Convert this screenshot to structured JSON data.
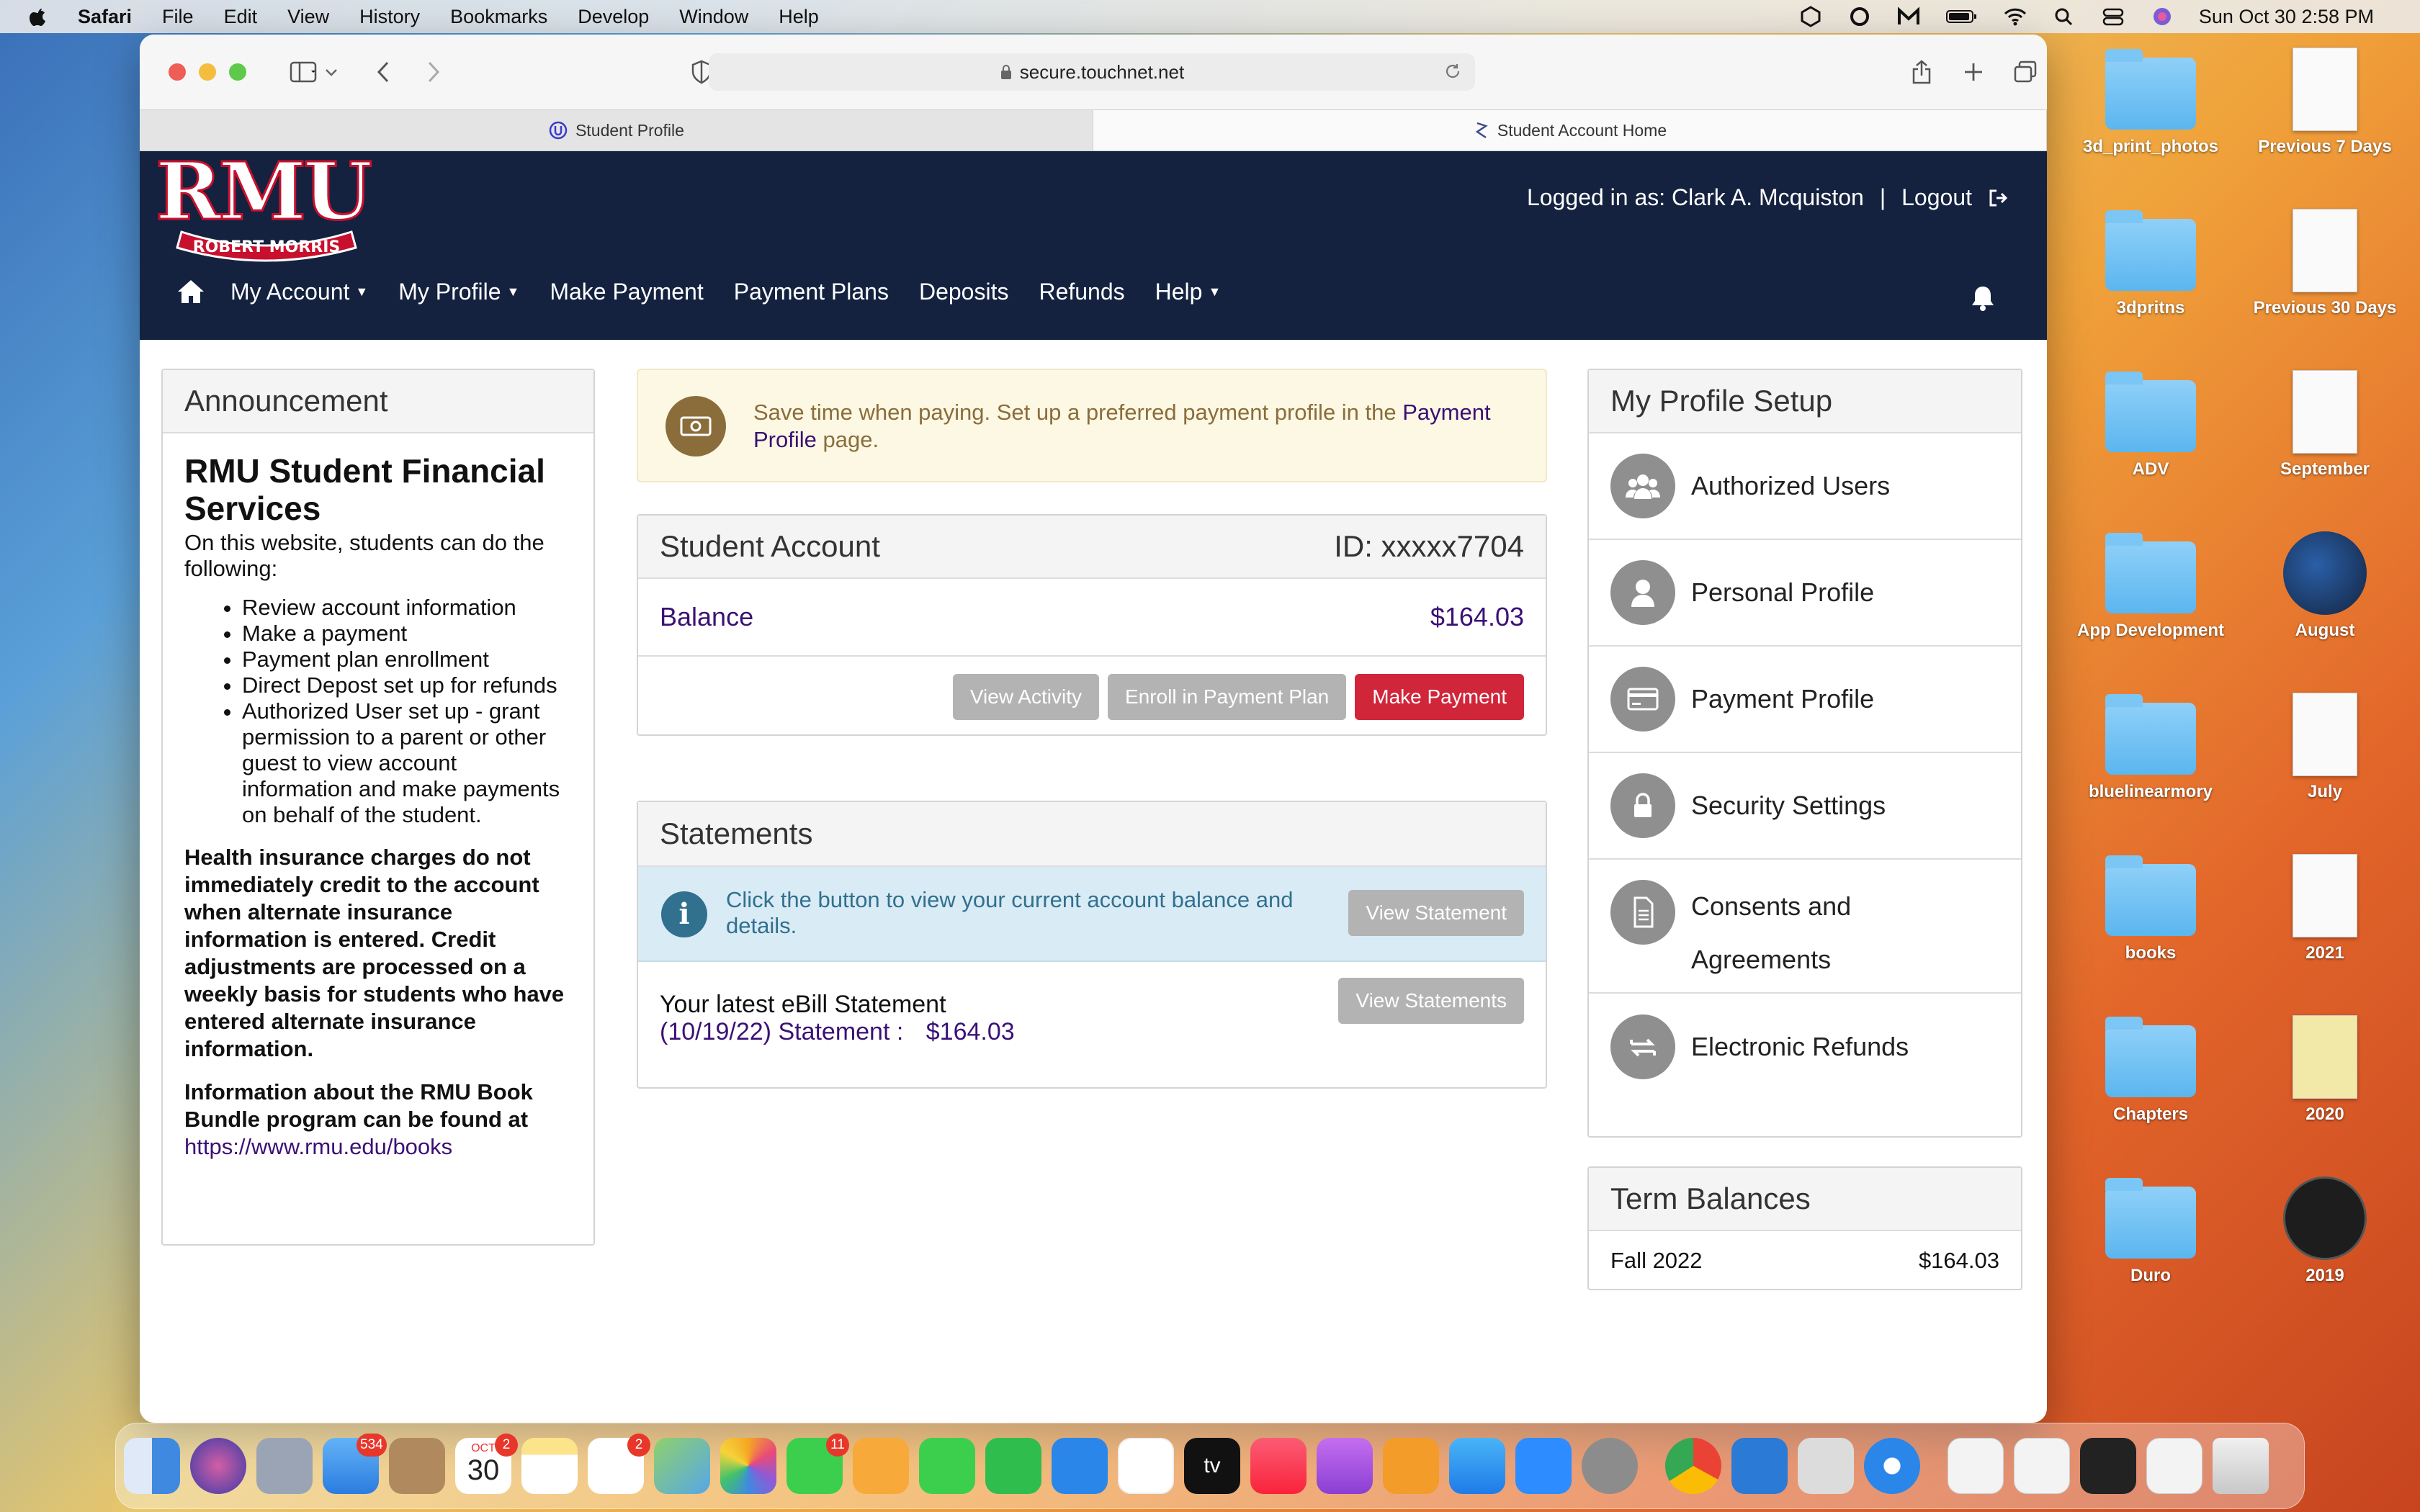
{
  "menubar": {
    "app": "Safari",
    "items": [
      "File",
      "Edit",
      "View",
      "History",
      "Bookmarks",
      "Develop",
      "Window",
      "Help"
    ],
    "clock": "Sun Oct 30  2:58 PM"
  },
  "browser": {
    "url": "secure.touchnet.net",
    "tabs": [
      {
        "label": "Student Profile",
        "icon": "touchnet-icon"
      },
      {
        "label": "Student Account Home",
        "icon": "touchnet-icon"
      }
    ]
  },
  "header": {
    "logo_text": "RMU",
    "logo_sub": "ROBERT MORRIS",
    "logged_in": "Logged in as: Clark A. Mcquiston",
    "separator": "|",
    "logout": "Logout",
    "nav": [
      {
        "label": "My Account",
        "dropdown": true
      },
      {
        "label": "My Profile",
        "dropdown": true
      },
      {
        "label": "Make Payment",
        "dropdown": false
      },
      {
        "label": "Payment Plans",
        "dropdown": false
      },
      {
        "label": "Deposits",
        "dropdown": false
      },
      {
        "label": "Refunds",
        "dropdown": false
      },
      {
        "label": "Help",
        "dropdown": true
      }
    ]
  },
  "announcement": {
    "heading": "Announcement",
    "title": "RMU Student Financial Services",
    "intro": "On this website, students can do the following:",
    "bullets": [
      "Review account information",
      "Make a payment",
      "Payment plan enrollment",
      "Direct Depost set up for refunds",
      "Authorized User set up - grant permission to a parent or other guest to view account information and make payments on behalf of the student."
    ],
    "health_note": "Health insurance charges do not immediately credit to the account when alternate insurance information is entered.  Credit adjustments are processed on a weekly basis for students who have entered alternate insurance information.",
    "book_note": "Information about the RMU Book Bundle program can be found at",
    "book_link": "https://www.rmu.edu/books"
  },
  "alert": {
    "text_before": "Save time when paying. Set up a preferred payment profile in the ",
    "link": "Payment Profile",
    "text_after": " page."
  },
  "student_account": {
    "title": "Student Account",
    "id": "ID: xxxxx7704",
    "balance_label": "Balance",
    "balance_value": "$164.03",
    "buttons": [
      "View Activity",
      "Enroll in Payment Plan",
      "Make Payment"
    ]
  },
  "statements": {
    "title": "Statements",
    "info_text": "Click the button to view your current account balance and details.",
    "view_statement": "View Statement",
    "latest_label": "Your latest eBill Statement",
    "latest_statement": "(10/19/22) Statement :",
    "latest_amount": "$164.03",
    "view_statements": "View Statements"
  },
  "profile_setup": {
    "title": "My Profile Setup",
    "items": [
      {
        "label": "Authorized Users",
        "icon": "users-icon"
      },
      {
        "label": "Personal Profile",
        "icon": "user-icon"
      },
      {
        "label": "Payment Profile",
        "icon": "credit-card-icon"
      },
      {
        "label": "Security Settings",
        "icon": "lock-icon"
      },
      {
        "label": "Consents and Agreements",
        "icon": "document-icon"
      },
      {
        "label": "Electronic Refunds",
        "icon": "refund-icon"
      }
    ]
  },
  "term_balances": {
    "title": "Term Balances",
    "rows": [
      {
        "term": "Fall 2022",
        "amount": "$164.03"
      }
    ]
  },
  "desktop": [
    {
      "label": "3d_print_photos",
      "kind": "folder"
    },
    {
      "label": "Previous 7 Days",
      "kind": "doc"
    },
    {
      "label": "3dpritns",
      "kind": "folder"
    },
    {
      "label": "Previous 30 Days",
      "kind": "doc"
    },
    {
      "label": "ADV",
      "kind": "folder"
    },
    {
      "label": "September",
      "kind": "doc"
    },
    {
      "label": "App Development",
      "kind": "folder"
    },
    {
      "label": "August",
      "kind": "steam"
    },
    {
      "label": "bluelinearmory",
      "kind": "folder"
    },
    {
      "label": "July",
      "kind": "doc"
    },
    {
      "label": "books",
      "kind": "folder"
    },
    {
      "label": "2021",
      "kind": "doc"
    },
    {
      "label": "Chapters",
      "kind": "folder"
    },
    {
      "label": "2020",
      "kind": "doc"
    },
    {
      "label": "Duro",
      "kind": "folder"
    },
    {
      "label": "2019",
      "kind": "round"
    }
  ],
  "dock": {
    "mail_badge": "534",
    "calendar_month": "OCT",
    "calendar_day": "30",
    "calendar_badge": "2",
    "reminders_badge": "2",
    "messages_badge": "11",
    "tv_label": "tv"
  }
}
